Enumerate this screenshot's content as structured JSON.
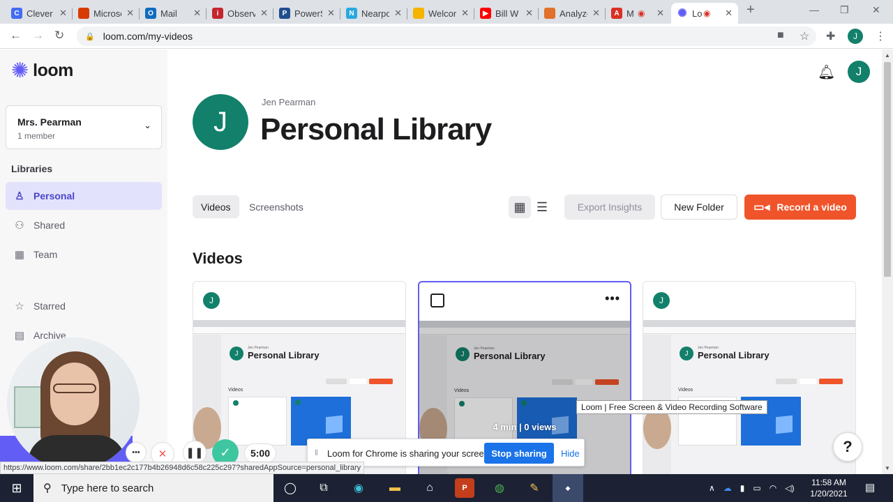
{
  "browser": {
    "tabs": [
      {
        "title": "Clever",
        "favicon": "clever-icon",
        "color": "#436cf2"
      },
      {
        "title": "Microsoft",
        "favicon": "office-icon",
        "color": "#d83b01"
      },
      {
        "title": "Mail",
        "favicon": "outlook-icon",
        "color": "#0f6cbd"
      },
      {
        "title": "Observe",
        "favicon": "observe-icon",
        "color": "#c4262e"
      },
      {
        "title": "PowerSchool",
        "favicon": "powerschool-icon",
        "color": "#1f4e8c"
      },
      {
        "title": "Nearpod",
        "favicon": "nearpod-icon",
        "color": "#2aa9e0"
      },
      {
        "title": "Welcome",
        "favicon": "slides-icon",
        "color": "#f4b400"
      },
      {
        "title": "Bill W",
        "favicon": "youtube-icon",
        "color": "#ff0000"
      },
      {
        "title": "Analyze",
        "favicon": "analyze-icon",
        "color": "#e0702a"
      },
      {
        "title": "M",
        "favicon": "alert-icon",
        "color": "#d93025"
      },
      {
        "title": "Loom",
        "favicon": "loom-icon",
        "color": "#625df5"
      }
    ],
    "url": "loom.com/my-videos",
    "status_url": "https://www.loom.com/share/2bb1ec2c177b4b26948d6c58c225c297?sharedAppSource=personal_library",
    "profile_initial": "J"
  },
  "sidebar": {
    "logo_text": "loom",
    "workspace": {
      "name": "Mrs. Pearman",
      "members": "1 member"
    },
    "libraries_title": "Libraries",
    "items": [
      {
        "label": "Personal",
        "icon": "person-icon",
        "active": true
      },
      {
        "label": "Shared",
        "icon": "people-icon",
        "active": false
      },
      {
        "label": "Team",
        "icon": "building-icon",
        "active": false
      },
      {
        "label": "Starred",
        "icon": "star-icon",
        "active": false
      },
      {
        "label": "Archive",
        "icon": "archive-icon",
        "active": false
      }
    ]
  },
  "header": {
    "user_initial": "J",
    "owner_name": "Jen Pearman",
    "title": "Personal Library"
  },
  "toolbar": {
    "tabs": [
      "Videos",
      "Screenshots"
    ],
    "export_label": "Export Insights",
    "new_folder_label": "New Folder",
    "record_label": "Record a video"
  },
  "videos": {
    "heading": "Videos",
    "cards": [
      {
        "avatar": "J",
        "thumb_owner": "Jen Pearman",
        "thumb_title": "Personal Library",
        "thumb_section": "Videos"
      },
      {
        "avatar": "J",
        "thumb_owner": "Jen Pearman",
        "thumb_title": "Personal Library",
        "thumb_section": "Videos",
        "stats": "4 min | 0 views"
      },
      {
        "avatar": "J",
        "thumb_owner": "Jen Pearman",
        "thumb_title": "Personal Library",
        "thumb_section": "Videos"
      }
    ]
  },
  "tooltip": "Loom | Free Screen & Video Recording Software",
  "recording": {
    "timer": "5:00"
  },
  "share_bar": {
    "message": "Loom for Chrome is sharing your screen.",
    "stop_label": "Stop sharing",
    "hide_label": "Hide"
  },
  "taskbar": {
    "search_placeholder": "Type here to search",
    "time": "11:58 AM",
    "date": "1/20/2021"
  },
  "colors": {
    "accent": "#625df5",
    "record": "#f0542a",
    "avatar": "#12806a"
  }
}
